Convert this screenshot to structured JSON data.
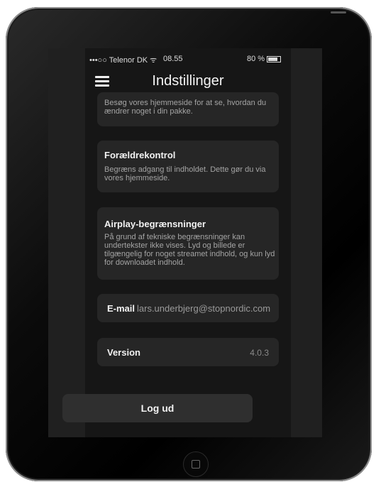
{
  "status_bar": {
    "carrier": "•••○○ Telenor DK ᯤ",
    "time": "08.55",
    "battery": "80 %"
  },
  "nav": {
    "title": "Indstillinger"
  },
  "sections": [
    {
      "description": "Besøg vores hjemmeside for at se, hvordan du ændrer noget i din pakke."
    },
    {
      "heading": "Forældrekontrol",
      "description": "Begræns adgang til indholdet. Dette gør du via vores hjemmeside."
    },
    {
      "heading": "Airplay-begrænsninger",
      "description": "På grund af tekniske begrænsninger kan undertekster ikke vises. Lyd og billede er tilgængelig for noget streamet indhold, og kun lyd for downloadet indhold."
    }
  ],
  "email": {
    "label": "E-mail",
    "value": "lars.underbjerg@stopnordic.com"
  },
  "version": {
    "label": "Version",
    "value": "4.0.3"
  },
  "logout_label": "Log ud",
  "icons": {
    "menu": "hamburger-menu-icon",
    "battery": "battery-icon",
    "home": "home-button-icon"
  }
}
